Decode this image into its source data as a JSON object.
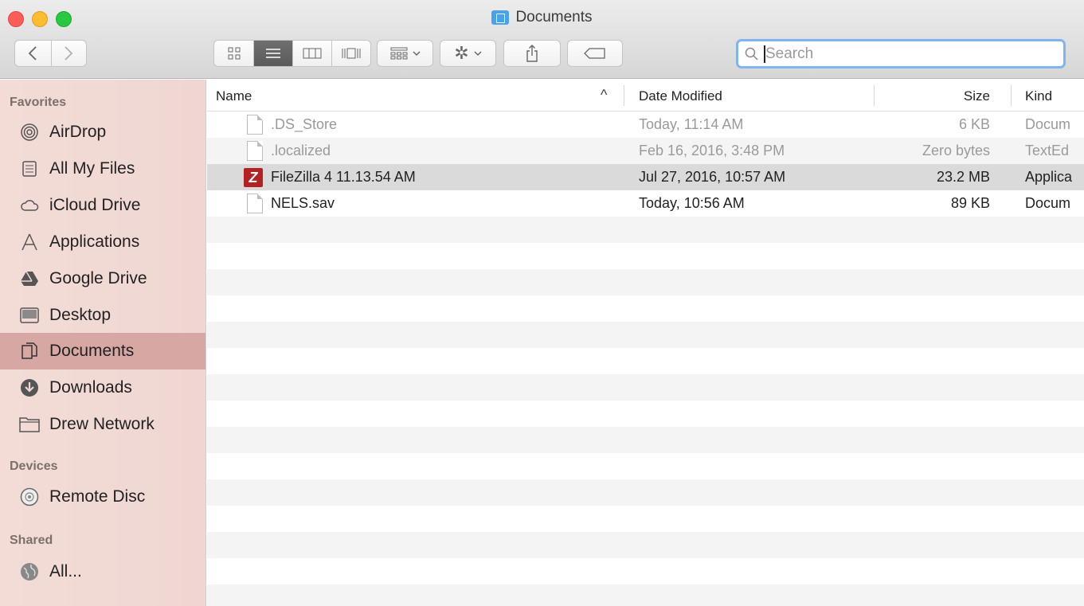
{
  "window": {
    "title": "Documents"
  },
  "toolbar": {
    "back_icon": "chevron-left-icon",
    "forward_icon": "chevron-right-icon",
    "view_modes": [
      "icon-view",
      "list-view",
      "column-view",
      "cover-flow-view"
    ],
    "active_view": "list-view",
    "search_placeholder": "Search"
  },
  "sidebar": {
    "favorites_header": "Favorites",
    "favorites": [
      {
        "label": "AirDrop",
        "icon": "airdrop-icon"
      },
      {
        "label": "All My Files",
        "icon": "all-files-icon"
      },
      {
        "label": "iCloud Drive",
        "icon": "cloud-icon"
      },
      {
        "label": "Applications",
        "icon": "applications-icon"
      },
      {
        "label": "Google Drive",
        "icon": "google-drive-icon"
      },
      {
        "label": "Desktop",
        "icon": "desktop-icon"
      },
      {
        "label": "Documents",
        "icon": "documents-icon",
        "selected": true
      },
      {
        "label": "Downloads",
        "icon": "downloads-icon"
      },
      {
        "label": "Drew Network",
        "icon": "folder-icon"
      }
    ],
    "devices_header": "Devices",
    "devices": [
      {
        "label": "Remote Disc",
        "icon": "disc-icon"
      }
    ],
    "shared_header": "Shared",
    "shared": [
      {
        "label": "All...",
        "icon": "network-icon"
      }
    ]
  },
  "columns": {
    "name": "Name",
    "sort_indicator": "^",
    "date": "Date Modified",
    "size": "Size",
    "kind": "Kind"
  },
  "files": [
    {
      "name": ".DS_Store",
      "date": "Today, 11:14 AM",
      "size": "6 KB",
      "kind": "Docum",
      "icon": "document-icon",
      "dimmed": true
    },
    {
      "name": ".localized",
      "date": "Feb 16, 2016, 3:48 PM",
      "size": "Zero bytes",
      "kind": "TextEd",
      "icon": "document-icon",
      "dimmed": true
    },
    {
      "name": "FileZilla 4 11.13.54 AM",
      "date": "Jul 27, 2016, 10:57 AM",
      "size": "23.2 MB",
      "kind": "Applica",
      "icon": "filezilla-icon",
      "selected": true
    },
    {
      "name": "NELS.sav",
      "date": "Today, 10:56 AM",
      "size": "89 KB",
      "kind": "Docum",
      "icon": "document-icon"
    }
  ],
  "colors": {
    "sidebar_selected": "#d6a7a3",
    "search_focus": "#7fb4f0",
    "row_selected": "#dadada",
    "filezilla_red": "#b22222"
  }
}
